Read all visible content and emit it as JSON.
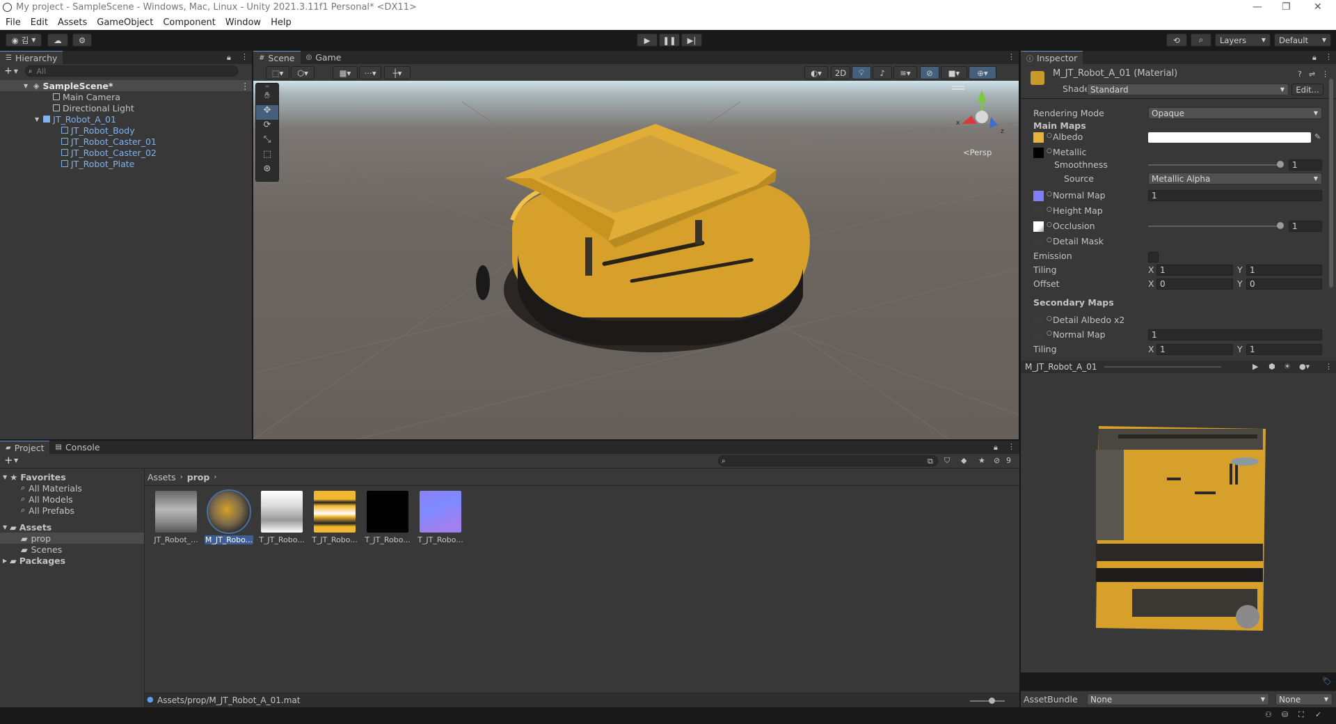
{
  "window": {
    "title": "My project - SampleScene - Windows, Mac, Linux - Unity 2021.3.11f1 Personal* <DX11>",
    "controls": [
      "—",
      "❐",
      "✕"
    ]
  },
  "menu": [
    "File",
    "Edit",
    "Assets",
    "GameObject",
    "Component",
    "Window",
    "Help"
  ],
  "toolbar": {
    "account_label": "김",
    "layers_label": "Layers",
    "layout_label": "Default"
  },
  "hierarchy": {
    "tab": "Hierarchy",
    "search_placeholder": "All",
    "scene": "SampleScene*",
    "items": [
      {
        "label": "Main Camera",
        "indent": 1,
        "blue": false
      },
      {
        "label": "Directional Light",
        "indent": 1,
        "blue": false
      },
      {
        "label": "JT_Robot_A_01",
        "indent": 1,
        "blue": true
      },
      {
        "label": "JT_Robot_Body",
        "indent": 2,
        "blue": true
      },
      {
        "label": "JT_Robot_Caster_01",
        "indent": 2,
        "blue": true
      },
      {
        "label": "JT_Robot_Caster_02",
        "indent": 2,
        "blue": true
      },
      {
        "label": "JT_Robot_Plate",
        "indent": 2,
        "blue": true
      }
    ]
  },
  "scene": {
    "tabs": [
      "Scene",
      "Game"
    ],
    "toggle_2d": "2D",
    "persp_label": "<Persp",
    "gizmo_x": "x",
    "gizmo_z": "z"
  },
  "inspector": {
    "tab": "Inspector",
    "material_name": "M_JT_Robot_A_01 (Material)",
    "shader_label": "Shader",
    "shader_value": "Standard",
    "edit_button": "Edit...",
    "rendering_mode_label": "Rendering Mode",
    "rendering_mode_value": "Opaque",
    "main_maps": "Main Maps",
    "albedo": "Albedo",
    "metallic": "Metallic",
    "smoothness": "Smoothness",
    "smoothness_value": "1",
    "smoothness_level": 1.0,
    "source": "Source",
    "source_value": "Metallic Alpha",
    "normal_map": "Normal Map",
    "normal_value": "1",
    "height_map": "Height Map",
    "occlusion": "Occlusion",
    "occlusion_value": "1",
    "occlusion_level": 1.0,
    "detail_mask": "Detail Mask",
    "emission": "Emission",
    "tiling": "Tiling",
    "offset": "Offset",
    "x": "X",
    "y": "Y",
    "tiling_x": "1",
    "tiling_y": "1",
    "offset_x": "0",
    "offset_y": "0",
    "secondary_maps": "Secondary Maps",
    "detail_albedo": "Detail Albedo x2",
    "normal_map_2": "Normal Map",
    "normal_value_2": "1",
    "tiling_2": "Tiling",
    "tiling2_x": "1",
    "tiling2_y": "1",
    "preview_title": "M_JT_Robot_A_01",
    "assetbundle_label": "AssetBundle",
    "assetbundle_value": "None",
    "assetbundle_variant": "None",
    "colors": {
      "albedo_swatch": "#e5b23a",
      "normal_swatch": "#7f7ff6"
    }
  },
  "project": {
    "tabs": [
      "Project",
      "Console"
    ],
    "favorites": "Favorites",
    "favorite_items": [
      "All Materials",
      "All Models",
      "All Prefabs"
    ],
    "assets": "Assets",
    "asset_folders": [
      "prop",
      "Scenes"
    ],
    "packages": "Packages",
    "breadcrumb": [
      "Assets",
      "prop"
    ],
    "hidden_count": "9",
    "files": [
      {
        "label": "JT_Robot_...",
        "kind": "model"
      },
      {
        "label": "M_JT_Robo...",
        "kind": "material",
        "selected": true
      },
      {
        "label": "T_JT_Robo...",
        "kind": "tex_white"
      },
      {
        "label": "T_JT_Robo...",
        "kind": "tex_yellow"
      },
      {
        "label": "T_JT_Robo...",
        "kind": "tex_black"
      },
      {
        "label": "T_JT_Robo...",
        "kind": "tex_normal"
      }
    ],
    "status_path": "Assets/prop/M_JT_Robot_A_01.mat"
  }
}
